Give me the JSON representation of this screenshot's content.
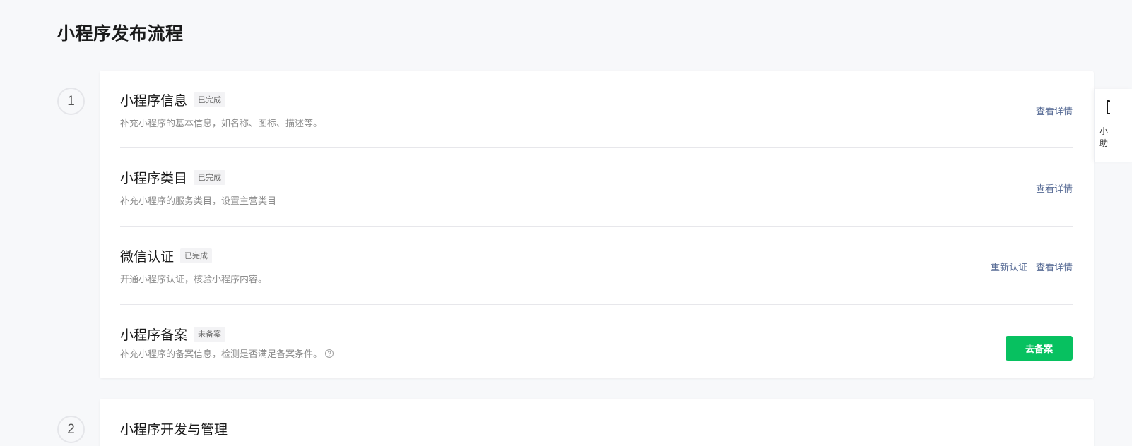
{
  "page": {
    "title": "小程序发布流程"
  },
  "steps": [
    {
      "number": "1",
      "items": [
        {
          "title": "小程序信息",
          "status": "已完成",
          "description": "补充小程序的基本信息，如名称、图标、描述等。",
          "actions": [
            "查看详情"
          ]
        },
        {
          "title": "小程序类目",
          "status": "已完成",
          "description": "补充小程序的服务类目，设置主营类目",
          "actions": [
            "查看详情"
          ]
        },
        {
          "title": "微信认证",
          "status": "已完成",
          "description": "开通小程序认证，核验小程序内容。",
          "actions": [
            "重新认证",
            "查看详情"
          ]
        },
        {
          "title": "小程序备案",
          "status": "未备案",
          "description": "补充小程序的备案信息，检测是否满足备案条件。",
          "help_icon": "question-circle-icon",
          "button_label": "去备案"
        }
      ]
    },
    {
      "number": "2",
      "title": "小程序开发与管理"
    }
  ],
  "side_widget": {
    "text": "小助",
    "icon": "bracket-icon"
  },
  "colors": {
    "primary_button": "#07c160",
    "link": "#576b95",
    "background": "#f7f8fa"
  }
}
